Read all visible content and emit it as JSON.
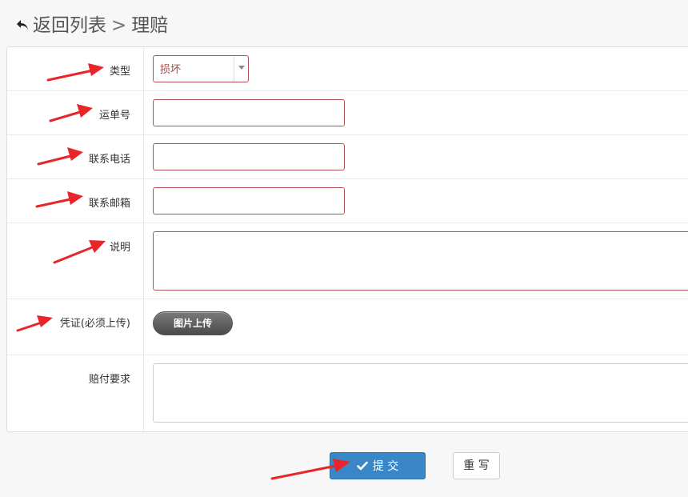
{
  "header": {
    "back_label": "返回列表",
    "separator": ">",
    "current": "理赔"
  },
  "form": {
    "type": {
      "label": "类型",
      "value": "损坏"
    },
    "tracking": {
      "label": "运单号",
      "value": ""
    },
    "phone": {
      "label": "联系电话",
      "value": ""
    },
    "email": {
      "label": "联系邮箱",
      "value": ""
    },
    "description": {
      "label": "说明",
      "value": ""
    },
    "proof": {
      "label": "凭证(必须上传)",
      "upload_label": "图片上传"
    },
    "claim": {
      "label": "赔付要求",
      "value": ""
    }
  },
  "actions": {
    "submit_label": "提 交",
    "reset_label": "重 写"
  },
  "colors": {
    "primary": "#3a87c8",
    "field_border_error": "#b0505a",
    "annotation_arrow": "#e8262a"
  },
  "icons": {
    "back": "undo-arrow-icon",
    "submit": "check-icon"
  }
}
